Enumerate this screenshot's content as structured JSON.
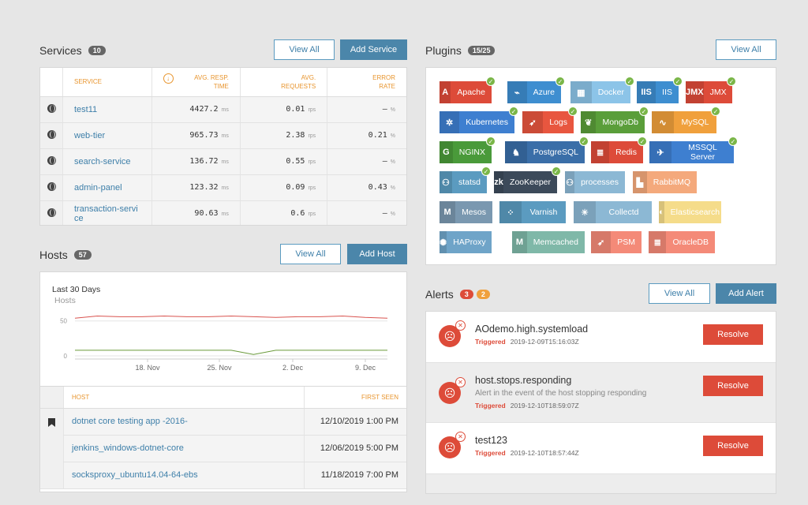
{
  "services": {
    "title": "Services",
    "count": "10",
    "view_all": "View All",
    "add": "Add Service",
    "headers": {
      "service": "SERVICE",
      "resp_l1": "AVG. RESP.",
      "resp_l2": "TIME",
      "req_l1": "AVG.",
      "req_l2": "REQUESTS",
      "err_l1": "ERROR",
      "err_l2": "RATE"
    },
    "rows": [
      {
        "name": "test11",
        "resp": "4427.2",
        "resp_unit": "ms",
        "req": "0.01",
        "req_unit": "rps",
        "err": "—",
        "err_unit": "%"
      },
      {
        "name": "web-tier",
        "resp": "965.73",
        "resp_unit": "ms",
        "req": "2.38",
        "req_unit": "rps",
        "err": "0.21",
        "err_unit": "%"
      },
      {
        "name": "search-service",
        "resp": "136.72",
        "resp_unit": "ms",
        "req": "0.55",
        "req_unit": "rps",
        "err": "—",
        "err_unit": "%"
      },
      {
        "name": "admin-panel",
        "resp": "123.32",
        "resp_unit": "ms",
        "req": "0.09",
        "req_unit": "rps",
        "err": "0.43",
        "err_unit": "%"
      },
      {
        "name_l1": "transaction-servi",
        "name_l2": "ce",
        "resp": "90.63",
        "resp_unit": "ms",
        "req": "0.6",
        "req_unit": "rps",
        "err": "—",
        "err_unit": "%"
      }
    ]
  },
  "hosts": {
    "title": "Hosts",
    "count": "57",
    "view_all": "View All",
    "add": "Add Host",
    "chart_title": "Last 30 Days",
    "chart_subtitle": "Hosts",
    "headers": {
      "host": "HOST",
      "first_seen": "FIRST SEEN"
    },
    "rows": [
      {
        "name": "dotnet core testing app -2016-",
        "seen": "12/10/2019 1:00 PM"
      },
      {
        "name": "jenkins_windows-dotnet-core",
        "seen": "12/06/2019 5:00 PM"
      },
      {
        "name": "socksproxy_ubuntu14.04-64-ebs",
        "seen": "11/18/2019 7:00 PM"
      }
    ]
  },
  "chart_data": {
    "type": "line",
    "title": "Last 30 Days",
    "ylabel": "Hosts",
    "x": [
      "18. Nov",
      "25. Nov",
      "2. Dec",
      "9. Dec"
    ],
    "yticks": [
      0,
      50
    ],
    "ylim": [
      0,
      70
    ],
    "series": [
      {
        "color": "#d9534f",
        "values": [
          54,
          57,
          56,
          56,
          57,
          56,
          56,
          57,
          56,
          55,
          56,
          56,
          57,
          55,
          54
        ]
      },
      {
        "color": "#6a9a3a",
        "values": [
          8,
          8,
          8,
          8,
          8,
          8,
          8,
          8,
          2,
          8,
          8,
          8,
          8,
          8,
          8
        ]
      }
    ],
    "grid": true
  },
  "plugins": {
    "title": "Plugins",
    "count": "15/25",
    "view_all": "View All",
    "items": [
      {
        "label": "Apache",
        "icon": "A",
        "color": "#dd4b39",
        "checked": true
      },
      {
        "label": "Azure",
        "icon": "⌁",
        "color": "#3e8ed0",
        "checked": true
      },
      {
        "label": "Docker",
        "icon": "▦",
        "color": "#8cc4e8",
        "checked": true
      },
      {
        "label": "IIS",
        "icon": "IIS",
        "color": "#3e8ed0",
        "checked": true
      },
      {
        "label": "JMX",
        "icon": "JMX",
        "color": "#dd4b39",
        "checked": true
      },
      {
        "label": "Kubernetes",
        "icon": "✲",
        "color": "#3e7fd0",
        "checked": true
      },
      {
        "label": "Logs",
        "icon": "➶",
        "color": "#e8563f",
        "checked": true
      },
      {
        "label": "MongoDb",
        "icon": "❦",
        "color": "#5a9e3a",
        "checked": true
      },
      {
        "label": "MySQL",
        "icon": "∿",
        "color": "#f0a03c",
        "checked": true
      },
      {
        "label": "NGINX",
        "icon": "G",
        "color": "#4a9a3a",
        "checked": true
      },
      {
        "label": "PostgreSQL",
        "icon": "♞",
        "color": "#3a6ea8",
        "checked": true
      },
      {
        "label": "Redis",
        "icon": "≣",
        "color": "#dd4b39",
        "checked": true
      },
      {
        "label": "MSSQL Server",
        "icon": "✈",
        "color": "#3e7fd0",
        "checked": true
      },
      {
        "label": "statsd",
        "icon": "⚇",
        "color": "#5b9bc0",
        "checked": true
      },
      {
        "label": "ZooKeeper",
        "icon": "zk",
        "color": "#3c4a5a",
        "checked": true
      },
      {
        "label": "processes",
        "icon": "⚇",
        "color": "#8cb8d4",
        "checked": false
      },
      {
        "label": "RabbitMQ",
        "icon": "▙",
        "color": "#f4a97c",
        "checked": false
      },
      {
        "label": "Mesos",
        "icon": "M",
        "color": "#7a98b0",
        "checked": false
      },
      {
        "label": "Varnish",
        "icon": "⁘",
        "color": "#5b9bc0",
        "checked": false
      },
      {
        "label": "Collectd",
        "icon": "☀",
        "color": "#8cb8d4",
        "checked": false
      },
      {
        "label": "Elasticsearch",
        "icon": "◐",
        "color": "#f5dc8a",
        "checked": false
      },
      {
        "label": "HAProxy",
        "icon": "✺",
        "color": "#6fa4c8",
        "checked": false
      },
      {
        "label": "Memcached",
        "icon": "M",
        "color": "#7fb8a8",
        "checked": false
      },
      {
        "label": "PSM",
        "icon": "➶",
        "color": "#f48a78",
        "checked": false
      },
      {
        "label": "OracleDB",
        "icon": "≣",
        "color": "#f48a78",
        "checked": false
      }
    ]
  },
  "alerts": {
    "title": "Alerts",
    "count_red": "3",
    "count_orange": "2",
    "view_all": "View All",
    "add": "Add Alert",
    "resolve": "Resolve",
    "items": [
      {
        "title": "AOdemo.high.systemload",
        "sub": "",
        "status": "Triggered",
        "time": "2019-12-09T15:16:03Z"
      },
      {
        "title": "host.stops.responding",
        "sub": "Alert in the event of the host stopping responding",
        "status": "Triggered",
        "time": "2019-12-10T18:59:07Z"
      },
      {
        "title": "test123",
        "sub": "",
        "status": "Triggered",
        "time": "2019-12-10T18:57:44Z"
      }
    ]
  }
}
